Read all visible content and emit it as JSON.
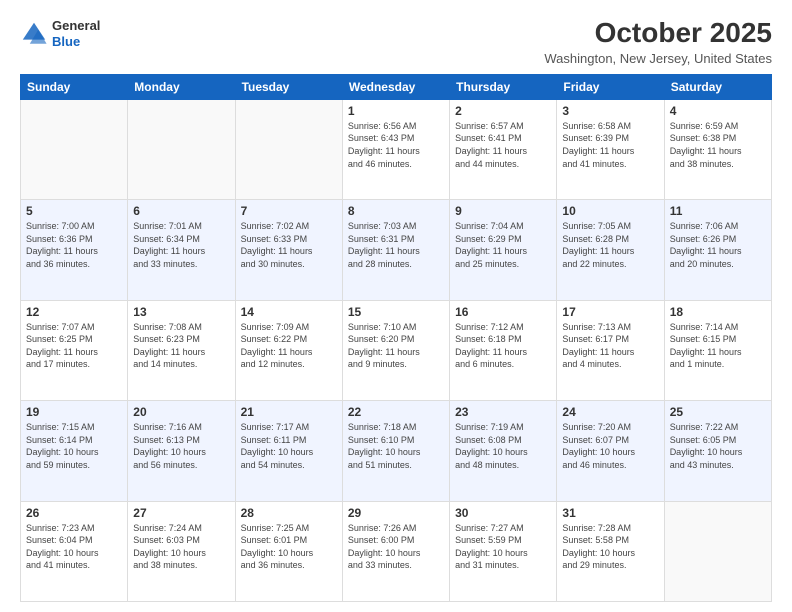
{
  "logo": {
    "general": "General",
    "blue": "Blue"
  },
  "header": {
    "title": "October 2025",
    "subtitle": "Washington, New Jersey, United States"
  },
  "days_of_week": [
    "Sunday",
    "Monday",
    "Tuesday",
    "Wednesday",
    "Thursday",
    "Friday",
    "Saturday"
  ],
  "weeks": [
    [
      {
        "day": "",
        "info": ""
      },
      {
        "day": "",
        "info": ""
      },
      {
        "day": "",
        "info": ""
      },
      {
        "day": "1",
        "info": "Sunrise: 6:56 AM\nSunset: 6:43 PM\nDaylight: 11 hours\nand 46 minutes."
      },
      {
        "day": "2",
        "info": "Sunrise: 6:57 AM\nSunset: 6:41 PM\nDaylight: 11 hours\nand 44 minutes."
      },
      {
        "day": "3",
        "info": "Sunrise: 6:58 AM\nSunset: 6:39 PM\nDaylight: 11 hours\nand 41 minutes."
      },
      {
        "day": "4",
        "info": "Sunrise: 6:59 AM\nSunset: 6:38 PM\nDaylight: 11 hours\nand 38 minutes."
      }
    ],
    [
      {
        "day": "5",
        "info": "Sunrise: 7:00 AM\nSunset: 6:36 PM\nDaylight: 11 hours\nand 36 minutes."
      },
      {
        "day": "6",
        "info": "Sunrise: 7:01 AM\nSunset: 6:34 PM\nDaylight: 11 hours\nand 33 minutes."
      },
      {
        "day": "7",
        "info": "Sunrise: 7:02 AM\nSunset: 6:33 PM\nDaylight: 11 hours\nand 30 minutes."
      },
      {
        "day": "8",
        "info": "Sunrise: 7:03 AM\nSunset: 6:31 PM\nDaylight: 11 hours\nand 28 minutes."
      },
      {
        "day": "9",
        "info": "Sunrise: 7:04 AM\nSunset: 6:29 PM\nDaylight: 11 hours\nand 25 minutes."
      },
      {
        "day": "10",
        "info": "Sunrise: 7:05 AM\nSunset: 6:28 PM\nDaylight: 11 hours\nand 22 minutes."
      },
      {
        "day": "11",
        "info": "Sunrise: 7:06 AM\nSunset: 6:26 PM\nDaylight: 11 hours\nand 20 minutes."
      }
    ],
    [
      {
        "day": "12",
        "info": "Sunrise: 7:07 AM\nSunset: 6:25 PM\nDaylight: 11 hours\nand 17 minutes."
      },
      {
        "day": "13",
        "info": "Sunrise: 7:08 AM\nSunset: 6:23 PM\nDaylight: 11 hours\nand 14 minutes."
      },
      {
        "day": "14",
        "info": "Sunrise: 7:09 AM\nSunset: 6:22 PM\nDaylight: 11 hours\nand 12 minutes."
      },
      {
        "day": "15",
        "info": "Sunrise: 7:10 AM\nSunset: 6:20 PM\nDaylight: 11 hours\nand 9 minutes."
      },
      {
        "day": "16",
        "info": "Sunrise: 7:12 AM\nSunset: 6:18 PM\nDaylight: 11 hours\nand 6 minutes."
      },
      {
        "day": "17",
        "info": "Sunrise: 7:13 AM\nSunset: 6:17 PM\nDaylight: 11 hours\nand 4 minutes."
      },
      {
        "day": "18",
        "info": "Sunrise: 7:14 AM\nSunset: 6:15 PM\nDaylight: 11 hours\nand 1 minute."
      }
    ],
    [
      {
        "day": "19",
        "info": "Sunrise: 7:15 AM\nSunset: 6:14 PM\nDaylight: 10 hours\nand 59 minutes."
      },
      {
        "day": "20",
        "info": "Sunrise: 7:16 AM\nSunset: 6:13 PM\nDaylight: 10 hours\nand 56 minutes."
      },
      {
        "day": "21",
        "info": "Sunrise: 7:17 AM\nSunset: 6:11 PM\nDaylight: 10 hours\nand 54 minutes."
      },
      {
        "day": "22",
        "info": "Sunrise: 7:18 AM\nSunset: 6:10 PM\nDaylight: 10 hours\nand 51 minutes."
      },
      {
        "day": "23",
        "info": "Sunrise: 7:19 AM\nSunset: 6:08 PM\nDaylight: 10 hours\nand 48 minutes."
      },
      {
        "day": "24",
        "info": "Sunrise: 7:20 AM\nSunset: 6:07 PM\nDaylight: 10 hours\nand 46 minutes."
      },
      {
        "day": "25",
        "info": "Sunrise: 7:22 AM\nSunset: 6:05 PM\nDaylight: 10 hours\nand 43 minutes."
      }
    ],
    [
      {
        "day": "26",
        "info": "Sunrise: 7:23 AM\nSunset: 6:04 PM\nDaylight: 10 hours\nand 41 minutes."
      },
      {
        "day": "27",
        "info": "Sunrise: 7:24 AM\nSunset: 6:03 PM\nDaylight: 10 hours\nand 38 minutes."
      },
      {
        "day": "28",
        "info": "Sunrise: 7:25 AM\nSunset: 6:01 PM\nDaylight: 10 hours\nand 36 minutes."
      },
      {
        "day": "29",
        "info": "Sunrise: 7:26 AM\nSunset: 6:00 PM\nDaylight: 10 hours\nand 33 minutes."
      },
      {
        "day": "30",
        "info": "Sunrise: 7:27 AM\nSunset: 5:59 PM\nDaylight: 10 hours\nand 31 minutes."
      },
      {
        "day": "31",
        "info": "Sunrise: 7:28 AM\nSunset: 5:58 PM\nDaylight: 10 hours\nand 29 minutes."
      },
      {
        "day": "",
        "info": ""
      }
    ]
  ]
}
